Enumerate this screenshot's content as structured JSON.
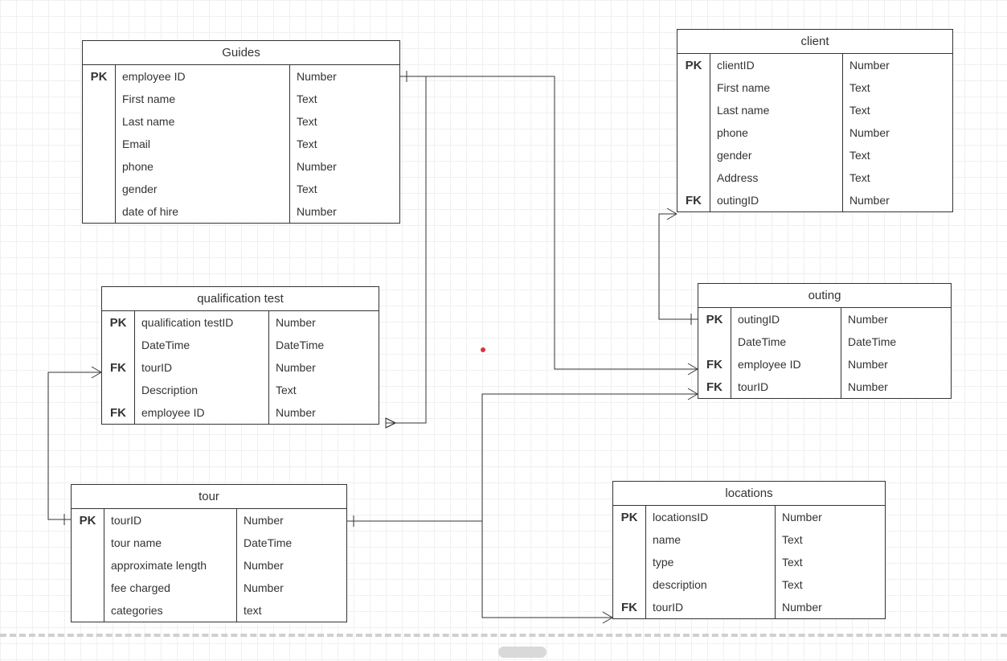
{
  "entities": {
    "guides": {
      "title": "Guides",
      "rows": [
        {
          "key": "PK",
          "name": "employee ID",
          "type": "Number"
        },
        {
          "key": "",
          "name": "First name",
          "type": "Text"
        },
        {
          "key": "",
          "name": "Last name",
          "type": "Text"
        },
        {
          "key": "",
          "name": "Email",
          "type": "Text"
        },
        {
          "key": "",
          "name": "phone",
          "type": "Number"
        },
        {
          "key": "",
          "name": "gender",
          "type": "Text"
        },
        {
          "key": "",
          "name": "date of hire",
          "type": "Number"
        }
      ]
    },
    "client": {
      "title": "client",
      "rows": [
        {
          "key": "PK",
          "name": "clientID",
          "type": "Number"
        },
        {
          "key": "",
          "name": "First name",
          "type": "Text"
        },
        {
          "key": "",
          "name": "Last name",
          "type": "Text"
        },
        {
          "key": "",
          "name": "phone",
          "type": "Number"
        },
        {
          "key": "",
          "name": "gender",
          "type": "Text"
        },
        {
          "key": "",
          "name": "Address",
          "type": "Text"
        },
        {
          "key": "FK",
          "name": "outingID",
          "type": "Number"
        }
      ]
    },
    "qualification": {
      "title": "qualification test",
      "rows": [
        {
          "key": "PK",
          "name": "qualification testID",
          "type": "Number"
        },
        {
          "key": "",
          "name": "DateTime",
          "type": "DateTime"
        },
        {
          "key": "FK",
          "name": "tourID",
          "type": "Number"
        },
        {
          "key": "",
          "name": "Description",
          "type": "Text"
        },
        {
          "key": "FK",
          "name": "employee ID",
          "type": "Number"
        }
      ]
    },
    "outing": {
      "title": "outing",
      "rows": [
        {
          "key": "PK",
          "name": "outingID",
          "type": "Number"
        },
        {
          "key": "",
          "name": "DateTime",
          "type": "DateTime"
        },
        {
          "key": "FK",
          "name": "employee ID",
          "type": "Number"
        },
        {
          "key": "FK",
          "name": "tourID",
          "type": "Number"
        }
      ]
    },
    "tour": {
      "title": "tour",
      "rows": [
        {
          "key": "PK",
          "name": "tourID",
          "type": "Number"
        },
        {
          "key": "",
          "name": "tour name",
          "type": "DateTime"
        },
        {
          "key": "",
          "name": "approximate length",
          "type": "Number"
        },
        {
          "key": "",
          "name": "fee charged",
          "type": "Number"
        },
        {
          "key": "",
          "name": "categories",
          "type": "text"
        }
      ]
    },
    "locations": {
      "title": "locations",
      "rows": [
        {
          "key": "PK",
          "name": "locationsID",
          "type": "Number"
        },
        {
          "key": "",
          "name": "name",
          "type": "Text"
        },
        {
          "key": "",
          "name": "type",
          "type": "Text"
        },
        {
          "key": "",
          "name": "description",
          "type": "Text"
        },
        {
          "key": "FK",
          "name": "tourID",
          "type": "Number"
        }
      ]
    }
  }
}
